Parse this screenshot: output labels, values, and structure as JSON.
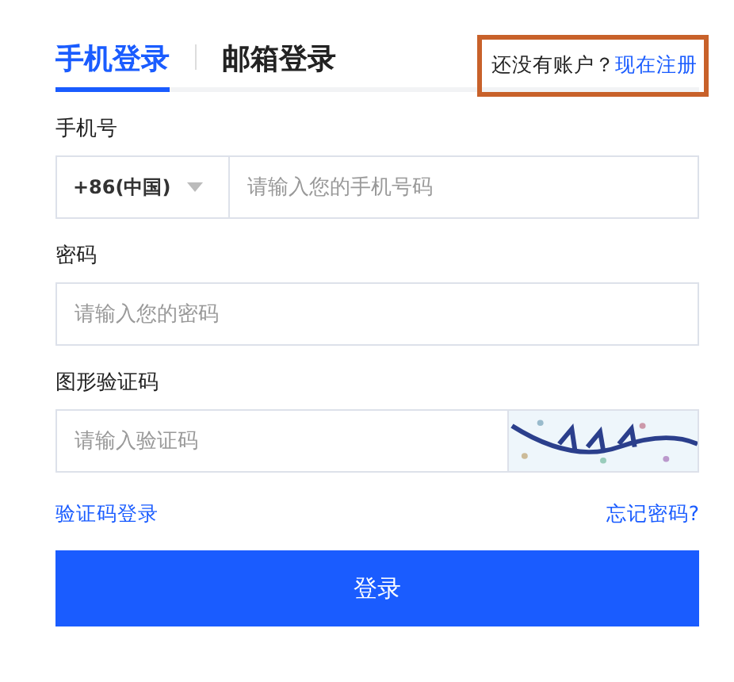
{
  "tabs": [
    {
      "label": "手机登录",
      "selected": true
    },
    {
      "label": "邮箱登录",
      "selected": false
    }
  ],
  "register_prompt": {
    "text": "还没有账户？",
    "link": "现在注册",
    "highlighted": true
  },
  "phone": {
    "label": "手机号",
    "country_code": "+86(中国)",
    "placeholder": "请输入您的手机号码"
  },
  "password": {
    "label": "密码",
    "placeholder": "请输入您的密码"
  },
  "captcha": {
    "label": "图形验证码",
    "placeholder": "请输入验证码"
  },
  "links": {
    "sms_login": "验证码登录",
    "forgot_password": "忘记密码?"
  },
  "submit_button": "登录"
}
